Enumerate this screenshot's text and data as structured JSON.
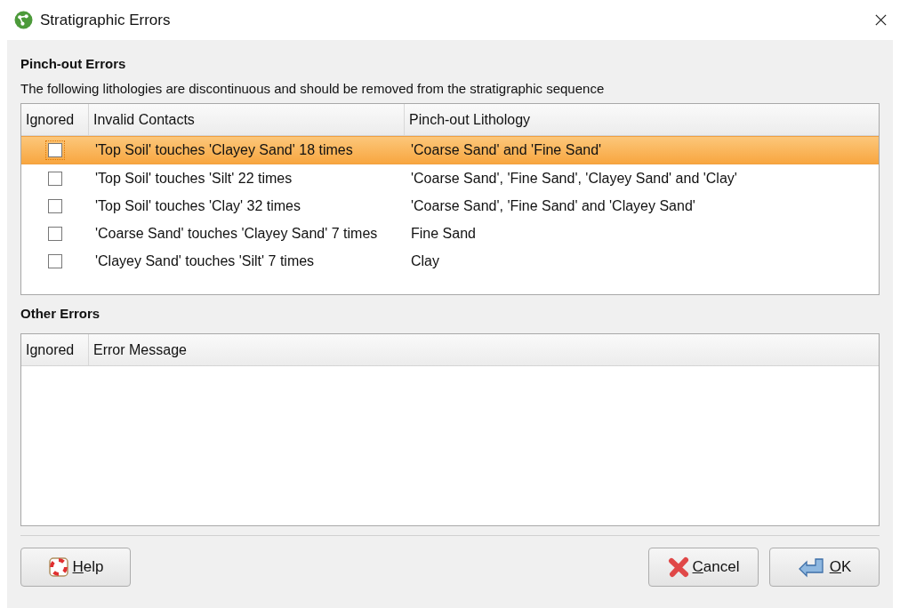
{
  "window": {
    "title": "Stratigraphic Errors"
  },
  "pinch_out": {
    "heading": "Pinch-out Errors",
    "description": "The following lithologies are discontinuous and should be removed from the stratigraphic sequence",
    "columns": [
      "Ignored",
      "Invalid Contacts",
      "Pinch-out Lithology"
    ],
    "rows": [
      {
        "ignored": false,
        "selected": true,
        "contact": "'Top Soil' touches 'Clayey Sand' 18 times",
        "lithology": "'Coarse Sand' and 'Fine Sand'"
      },
      {
        "ignored": false,
        "selected": false,
        "contact": "'Top Soil' touches 'Silt' 22 times",
        "lithology": "'Coarse Sand', 'Fine Sand', 'Clayey Sand' and 'Clay'"
      },
      {
        "ignored": false,
        "selected": false,
        "contact": "'Top Soil' touches 'Clay' 32 times",
        "lithology": "'Coarse Sand', 'Fine Sand' and 'Clayey Sand'"
      },
      {
        "ignored": false,
        "selected": false,
        "contact": "'Coarse Sand' touches 'Clayey Sand' 7 times",
        "lithology": "Fine Sand"
      },
      {
        "ignored": false,
        "selected": false,
        "contact": "'Clayey Sand' touches 'Silt' 7 times",
        "lithology": "Clay"
      }
    ]
  },
  "other": {
    "heading": "Other Errors",
    "columns": [
      "Ignored",
      "Error Message"
    ]
  },
  "buttons": [
    {
      "kind": "help",
      "label": "Help"
    },
    {
      "kind": "cancel",
      "label": "Cancel"
    },
    {
      "kind": "ok",
      "label": "OK"
    }
  ]
}
